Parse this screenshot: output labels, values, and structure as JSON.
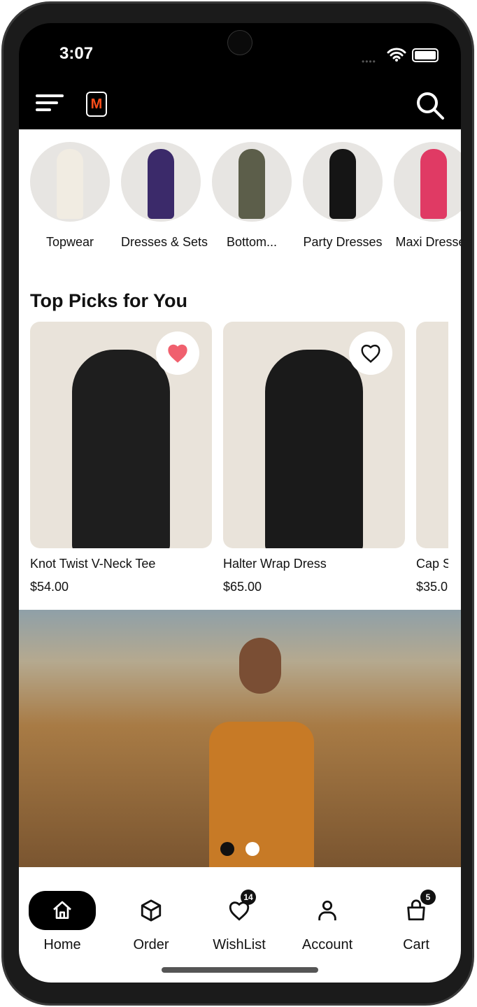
{
  "status_bar": {
    "time": "3:07"
  },
  "app_bar": {
    "logo": "M",
    "icons": [
      "menu-icon",
      "search-icon"
    ]
  },
  "categories": [
    {
      "label": "Topwear"
    },
    {
      "label": "Dresses & Sets"
    },
    {
      "label": "Bottom..."
    },
    {
      "label": "Party Dresses"
    },
    {
      "label": "Maxi Dresses"
    }
  ],
  "top_picks": {
    "title": "Top Picks for You",
    "items": [
      {
        "name": "Knot Twist V-Neck Tee",
        "price": "$54.00",
        "wishlisted": true
      },
      {
        "name": "Halter Wrap Dress",
        "price": "$65.00",
        "wishlisted": false
      },
      {
        "name": "Cap S",
        "price": "$35.0",
        "wishlisted": false
      }
    ]
  },
  "banner": {
    "slides": 2,
    "active_slide": 1
  },
  "bottom_nav": {
    "items": [
      {
        "label": "Home",
        "icon": "home-icon",
        "active": true
      },
      {
        "label": "Order",
        "icon": "box-icon"
      },
      {
        "label": "WishList",
        "icon": "heart-icon",
        "badge": "14"
      },
      {
        "label": "Account",
        "icon": "user-icon"
      },
      {
        "label": "Cart",
        "icon": "bag-icon",
        "badge": "5"
      }
    ]
  },
  "colors": {
    "accent": "#000000",
    "wishlist_heart": "#f0606e",
    "logo": "#ff4d1a"
  }
}
